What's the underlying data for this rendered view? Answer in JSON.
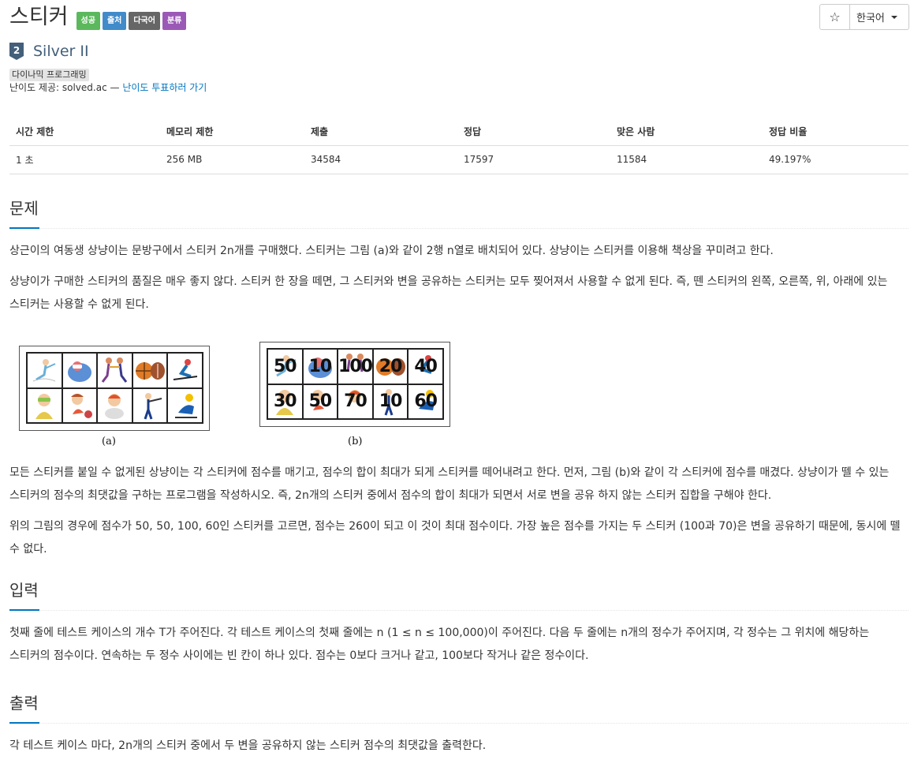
{
  "header": {
    "title": "스티커",
    "labels": [
      {
        "text": "성공",
        "color": "#5cb85c"
      },
      {
        "text": "출처",
        "color": "#428bca"
      },
      {
        "text": "다국어",
        "color": "#666666"
      },
      {
        "text": "분류",
        "color": "#9b59b6"
      }
    ],
    "language": "한국어",
    "star_icon": "star-outline-icon"
  },
  "tier": {
    "number": "2",
    "name": "Silver II",
    "color": "#435f7a"
  },
  "tags": [
    "다이나믹 프로그래밍"
  ],
  "credit": {
    "prefix": "난이도 제공: solved.ac —",
    "link": "난이도 투표하러 가기"
  },
  "stats": {
    "headers": [
      "시간 제한",
      "메모리 제한",
      "제출",
      "정답",
      "맞은 사람",
      "정답 비율"
    ],
    "values": [
      "1 초",
      "256 MB",
      "34584",
      "17597",
      "11584",
      "49.197%"
    ]
  },
  "problem": {
    "heading": "문제",
    "p1": "상근이의 여동생 상냥이는 문방구에서 스티커 2n개를 구매했다. 스티커는 그림 (a)와 같이 2행 n열로 배치되어 있다. 상냥이는 스티커를 이용해 책상을 꾸미려고 한다.",
    "p2": "상냥이가 구매한 스티커의 품질은 매우 좋지 않다. 스티커 한 장을 떼면, 그 스티커와 변을 공유하는 스티커는 모두 찢어져서 사용할 수 없게 된다. 즉, 뗀 스티커의 왼쪽, 오른쪽, 위, 아래에 있는 스티커는 사용할 수 없게 된다.",
    "p3": "모든 스티커를 붙일 수 없게된 상냥이는 각 스티커에 점수를 매기고, 점수의 합이 최대가 되게 스티커를 떼어내려고 한다. 먼저, 그림 (b)와 같이 각 스티커에 점수를 매겼다. 상냥이가 뗄 수 있는 스티커의 점수의 최댓값을 구하는 프로그램을 작성하시오. 즉, 2n개의 스티커 중에서 점수의 합이 최대가 되면서 서로 변을 공유 하지 않는 스티커 집합을 구해야 한다.",
    "p4": "위의 그림의 경우에 점수가 50, 50, 100, 60인 스티커를 고르면, 점수는 260이 되고 이 것이 최대 점수이다. 가장 높은 점수를 가지는 두 스티커 (100과 70)은 변을 공유하기 때문에, 동시에 뗄 수 없다."
  },
  "figure": {
    "caption_a": "(a)",
    "caption_b": "(b)",
    "scores_top": [
      "50",
      "10",
      "100",
      "20",
      "40"
    ],
    "scores_bottom": [
      "30",
      "50",
      "70",
      "10",
      "60"
    ]
  },
  "input": {
    "heading": "입력",
    "p1": "첫째 줄에 테스트 케이스의 개수 T가 주어진다. 각 테스트 케이스의 첫째 줄에는 n (1 ≤ n ≤ 100,000)이 주어진다. 다음 두 줄에는 n개의 정수가 주어지며, 각 정수는 그 위치에 해당하는 스티커의 점수이다. 연속하는 두 정수 사이에는 빈 칸이 하나 있다. 점수는 0보다 크거나 같고, 100보다 작거나 같은 정수이다."
  },
  "output": {
    "heading": "출력",
    "p1": "각 테스트 케이스 마다, 2n개의 스티커 중에서 두 변을 공유하지 않는 스티커 점수의 최댓값을 출력한다."
  }
}
